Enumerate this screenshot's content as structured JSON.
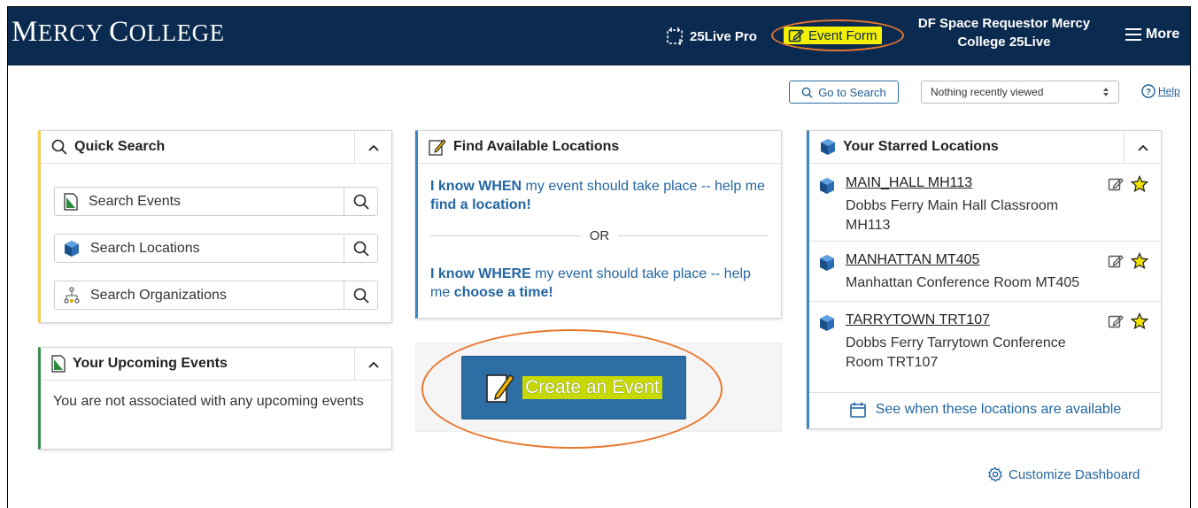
{
  "navbar": {
    "logo": {
      "first_big": "M",
      "first_rest": "ERCY ",
      "second_big": "C",
      "second_rest": "OLLEGE"
    },
    "pro_label": "25Live Pro",
    "event_form_label": "Event Form",
    "user_line1": "DF Space Requestor Mercy",
    "user_line2": "College 25Live",
    "more_label": "More"
  },
  "toolbar": {
    "go_to_search_label": "Go to Search",
    "recent_selected": "Nothing recently viewed",
    "help_label": "Help"
  },
  "quick_search": {
    "title": "Quick Search",
    "rows": [
      {
        "label": "Search Events",
        "icon": "event-doc-icon"
      },
      {
        "label": "Search Locations",
        "icon": "location-cube-icon"
      },
      {
        "label": "Search Organizations",
        "icon": "organization-icon"
      }
    ]
  },
  "upcoming": {
    "title": "Your Upcoming Events",
    "message": "You are not associated with any upcoming events"
  },
  "find_locations": {
    "title": "Find Available Locations",
    "when_bold": "I know WHEN",
    "when_text": " my event should take place -- help me ",
    "when_link": "find a location!",
    "or_label": "OR",
    "where_bold": "I know WHERE",
    "where_text": " my event should take place -- help me ",
    "where_link": "choose a time!"
  },
  "create_event": {
    "label": "Create an Event"
  },
  "starred": {
    "title": "Your Starred Locations",
    "items": [
      {
        "name": "MAIN_HALL MH113",
        "desc": "Dobbs Ferry Main Hall Classroom MH113"
      },
      {
        "name": "MANHATTAN MT405",
        "desc": "Manhattan Conference Room MT405"
      },
      {
        "name": "TARRYTOWN TRT107",
        "desc": "Dobbs Ferry Tarrytown Conference Room TRT107"
      }
    ],
    "footer_label": "See when these locations are available"
  },
  "customize_label": "Customize Dashboard",
  "colors": {
    "navbar": "#0b2a4f",
    "highlight": "#f4f000",
    "annotation": "#e8772e",
    "link": "#2466a2",
    "button": "#2d6ea4"
  }
}
